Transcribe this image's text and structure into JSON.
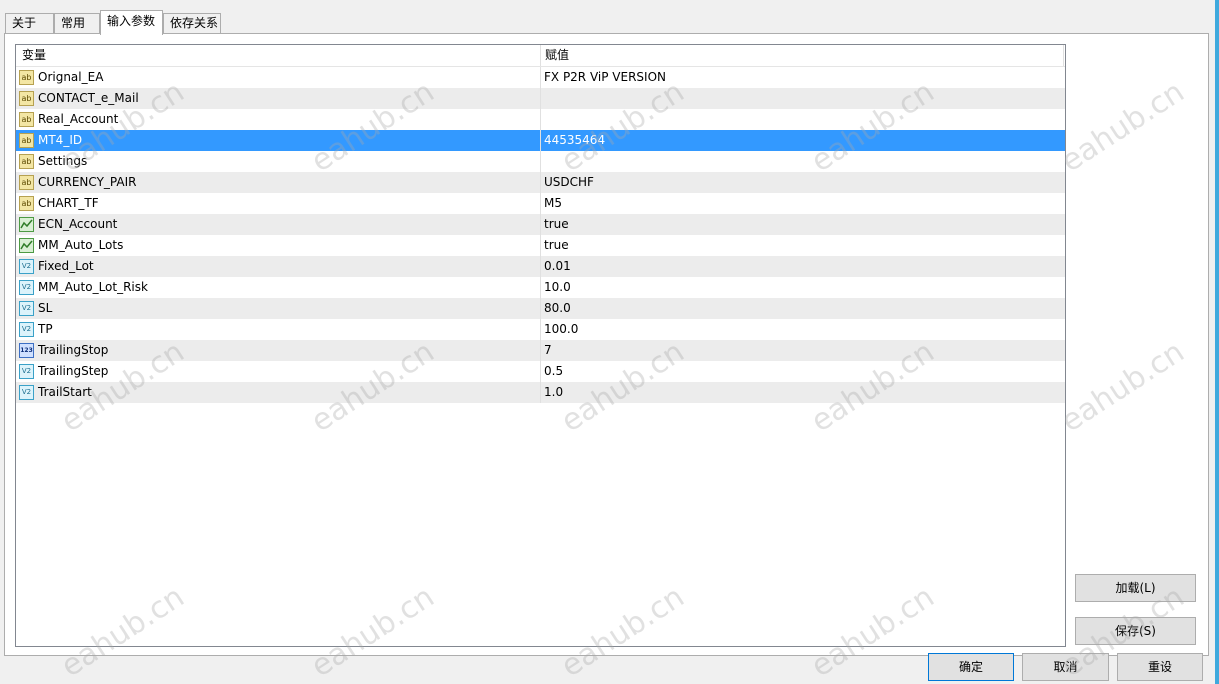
{
  "tabs": [
    {
      "label": "关于"
    },
    {
      "label": "常用"
    },
    {
      "label": "输入参数",
      "active": true
    },
    {
      "label": "依存关系"
    }
  ],
  "grid": {
    "headers": {
      "variable": "变量",
      "value": "赋值"
    },
    "rows": [
      {
        "name": "Orignal_EA",
        "value": "FX P2R ViP VERSION",
        "type": "string"
      },
      {
        "name": "CONTACT_e_Mail",
        "value": "",
        "type": "string"
      },
      {
        "name": "Real_Account",
        "value": "",
        "type": "string"
      },
      {
        "name": "MT4_ID",
        "value": "44535464",
        "type": "string",
        "selected": true
      },
      {
        "name": "Settings",
        "value": "",
        "type": "string"
      },
      {
        "name": "CURRENCY_PAIR",
        "value": "USDCHF",
        "type": "string"
      },
      {
        "name": "CHART_TF",
        "value": "M5",
        "type": "string"
      },
      {
        "name": "ECN_Account",
        "value": "true",
        "type": "bool"
      },
      {
        "name": "MM_Auto_Lots",
        "value": "true",
        "type": "bool"
      },
      {
        "name": "Fixed_Lot",
        "value": "0.01",
        "type": "double"
      },
      {
        "name": "MM_Auto_Lot_Risk",
        "value": "10.0",
        "type": "double"
      },
      {
        "name": "SL",
        "value": "80.0",
        "type": "double"
      },
      {
        "name": "TP",
        "value": "100.0",
        "type": "double"
      },
      {
        "name": "TrailingStop",
        "value": "7",
        "type": "int"
      },
      {
        "name": "TrailingStep",
        "value": "0.5",
        "type": "double"
      },
      {
        "name": "TrailStart",
        "value": "1.0",
        "type": "double"
      }
    ]
  },
  "icons": {
    "string": {
      "name": "string-type-icon",
      "glyph": "ab"
    },
    "bool": {
      "name": "bool-type-icon",
      "glyph": ""
    },
    "double": {
      "name": "double-type-icon",
      "glyph": "V2"
    },
    "int": {
      "name": "int-type-icon",
      "glyph": "123"
    }
  },
  "side_buttons": {
    "load": "加载(L)",
    "save": "保存(S)"
  },
  "footer_buttons": {
    "ok": "确定",
    "cancel": "取消",
    "reset": "重设"
  },
  "watermark": {
    "text": "eahub.cn"
  },
  "colors": {
    "selection": "#3399ff",
    "window_accent": "#3fa9dd"
  }
}
